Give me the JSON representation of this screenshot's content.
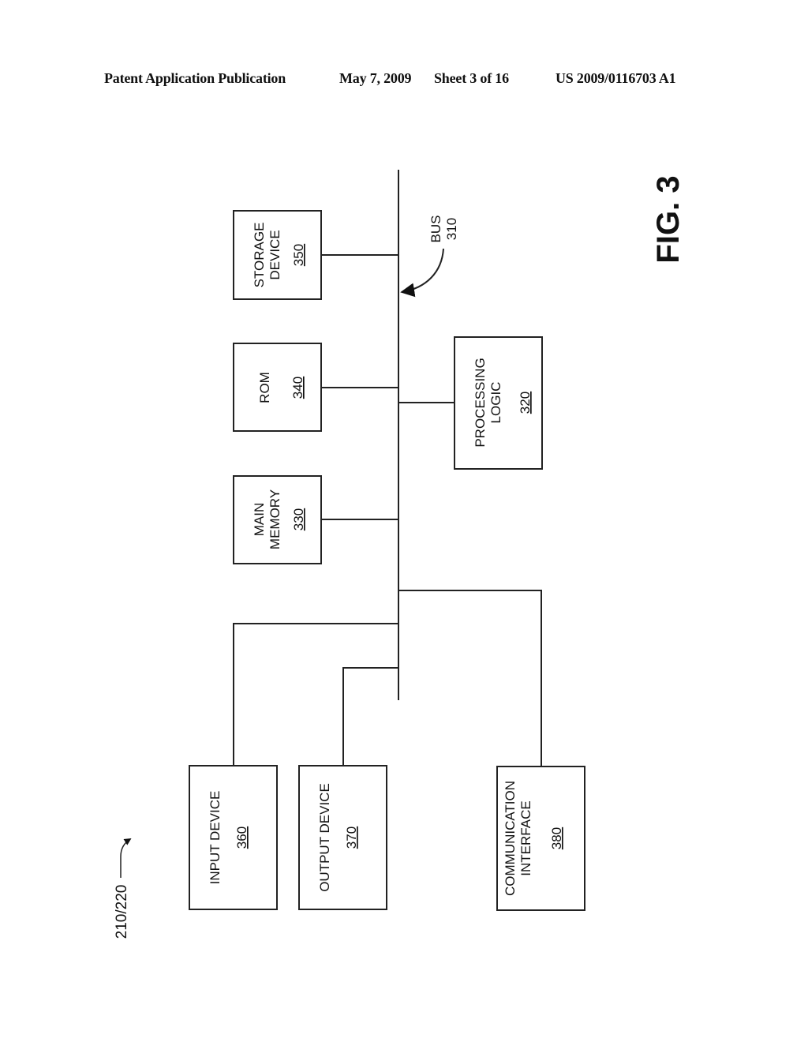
{
  "header": {
    "publication": "Patent Application Publication",
    "date": "May 7, 2009",
    "sheet": "Sheet 3 of 16",
    "number": "US 2009/0116703 A1"
  },
  "figure": {
    "label": "FIG. 3",
    "ref": "210/220",
    "bus": {
      "name": "BUS",
      "number": "310"
    },
    "components": {
      "processing_logic": {
        "lines": [
          "PROCESSING",
          "LOGIC"
        ],
        "number": "320"
      },
      "main_memory": {
        "lines": [
          "MAIN",
          "MEMORY"
        ],
        "number": "330"
      },
      "rom": {
        "lines": [
          "ROM"
        ],
        "number": "340"
      },
      "storage_device": {
        "lines": [
          "STORAGE",
          "DEVICE"
        ],
        "number": "350"
      },
      "input_device": {
        "lines": [
          "INPUT DEVICE"
        ],
        "number": "360"
      },
      "output_device": {
        "lines": [
          "OUTPUT DEVICE"
        ],
        "number": "370"
      },
      "communication_interface": {
        "lines": [
          "COMMUNICATION",
          "INTERFACE"
        ],
        "number": "380"
      }
    }
  }
}
